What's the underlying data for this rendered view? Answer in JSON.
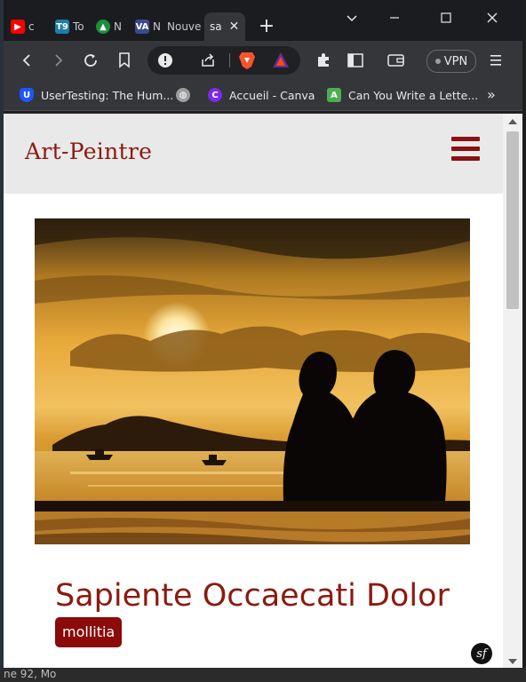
{
  "tabs": [
    {
      "label": "c",
      "icon": "youtube-icon",
      "color": "#ff0000"
    },
    {
      "label": "To",
      "icon": "t9-icon",
      "color": "#1d7fa8"
    },
    {
      "label": "N",
      "icon": "drive-icon",
      "color": "#1e8e3e"
    },
    {
      "label": "N",
      "icon": "va-icon",
      "color": "#3c4a8c"
    },
    {
      "label": "Nouve",
      "icon": "",
      "color": ""
    },
    {
      "label": "sa",
      "icon": "",
      "color": ""
    }
  ],
  "toolbar": {
    "vpn_label": "VPN"
  },
  "bookmarks": [
    {
      "label": "UserTesting: The Hum...",
      "icon": "usertesting-icon",
      "color": "#1f56ff"
    },
    {
      "label": "",
      "icon": "globe-icon",
      "color": "#9e9e9e"
    },
    {
      "label": "Accueil - Canva",
      "icon": "canva-icon",
      "color": "#7d2ae8"
    },
    {
      "label": "Can You Write a Lette...",
      "icon": "a-icon",
      "color": "#4caf50"
    }
  ],
  "site": {
    "brand": "Art-Peintre",
    "accent": "#8b1a10",
    "post_title": "Sapiente Occaecati Dolor",
    "tag": "mollitia",
    "badge": "sf"
  },
  "desktop": {
    "status_text": "ne 92, Mo"
  }
}
